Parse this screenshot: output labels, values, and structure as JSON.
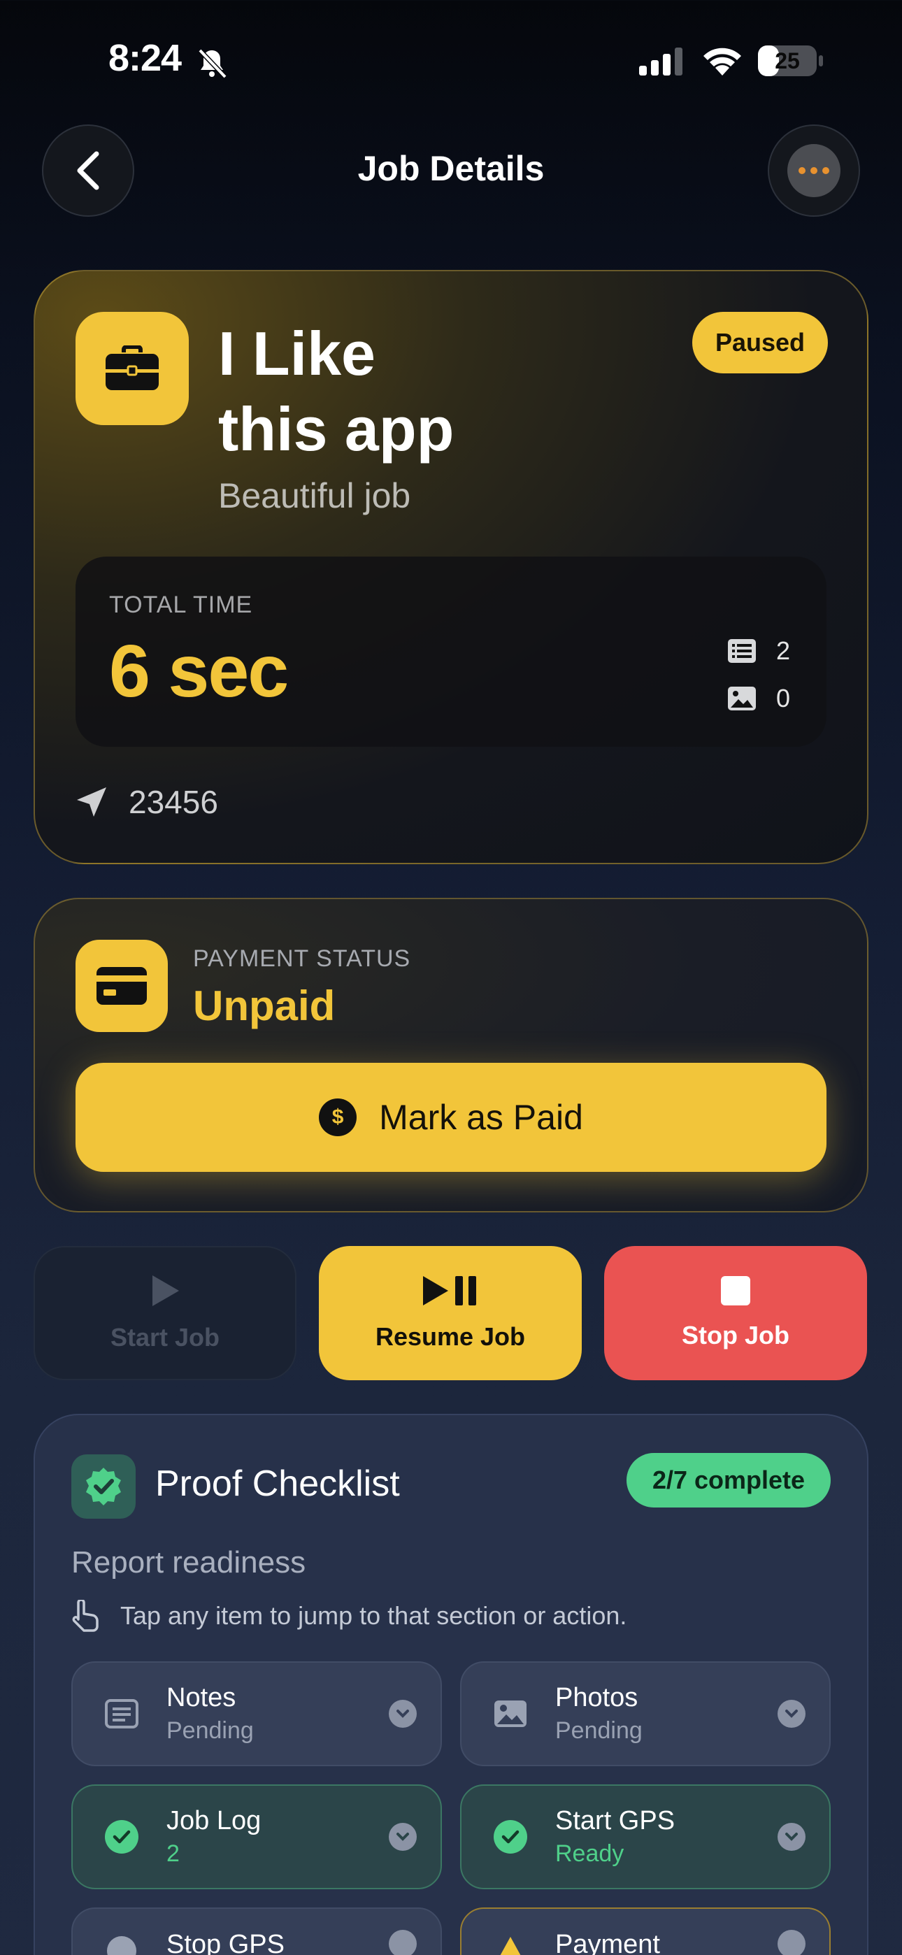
{
  "status_bar": {
    "time": "8:24",
    "battery": "25"
  },
  "nav": {
    "title": "Job Details"
  },
  "job": {
    "title_line1": "I Like",
    "title_line2": "this app",
    "subtitle": "Beautiful job",
    "status": "Paused",
    "total_time_label": "TOTAL TIME",
    "total_time": "6 sec",
    "notes_count": "2",
    "photos_count": "0",
    "location": "23456"
  },
  "payment": {
    "label": "PAYMENT STATUS",
    "value": "Unpaid",
    "coin_symbol": "$",
    "button_label": "Mark as Paid"
  },
  "actions": {
    "start": "Start Job",
    "resume": "Resume Job",
    "stop": "Stop Job"
  },
  "checklist": {
    "title": "Proof Checklist",
    "progress": "2/7 complete",
    "readiness": "Report readiness",
    "hint": "Tap any item to jump to that section or action.",
    "items": [
      {
        "name": "Notes",
        "state": "Pending",
        "icon": "notes-icon"
      },
      {
        "name": "Photos",
        "state": "Pending",
        "icon": "photo-icon"
      },
      {
        "name": "Job Log",
        "state": "2",
        "icon": "check-icon"
      },
      {
        "name": "Start GPS",
        "state": "Ready",
        "icon": "check-icon"
      },
      {
        "name": "Stop GPS",
        "state": "",
        "icon": "pending-icon"
      },
      {
        "name": "Payment",
        "state": "",
        "icon": "warning-icon"
      }
    ]
  },
  "colors": {
    "accent": "#f2c53a",
    "danger": "#ea5352",
    "success": "#4fd08a",
    "card": "#27314a"
  }
}
